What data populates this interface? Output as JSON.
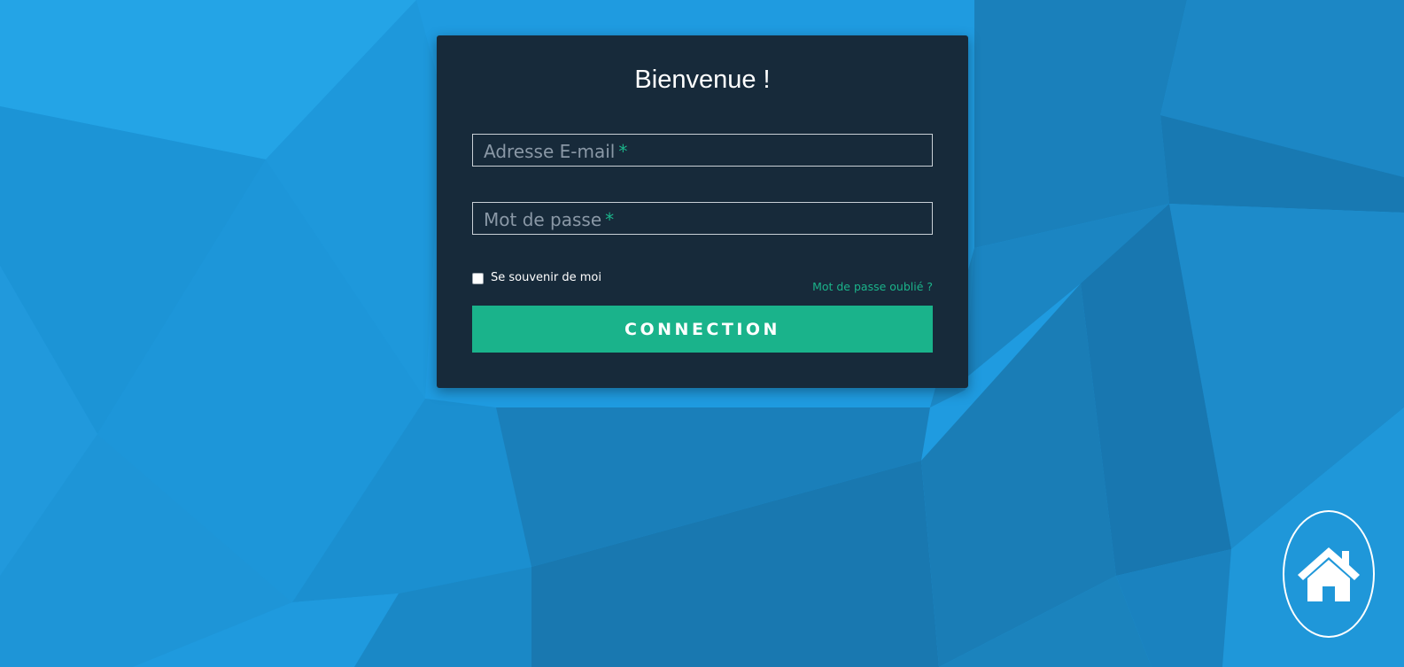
{
  "page": {
    "background_color": "#1f9be0"
  },
  "login": {
    "title": "Bienvenue !",
    "email": {
      "label": "Adresse E-mail",
      "required_marker": "*",
      "value": ""
    },
    "password": {
      "label": "Mot de passe",
      "required_marker": "*",
      "value": ""
    },
    "remember": {
      "label": "Se souvenir de moi",
      "checked": false
    },
    "forgot_link": "Mot de passe oublié ?",
    "submit_label": "CONNECTION",
    "colors": {
      "card": "#172a3a",
      "accent": "#1ab38b"
    }
  },
  "home_button": {
    "icon": "home-icon"
  }
}
